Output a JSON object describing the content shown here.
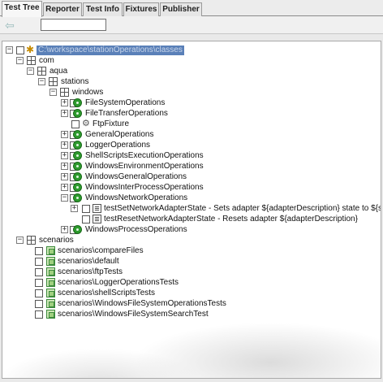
{
  "tabs": [
    {
      "label": "Test Tree",
      "active": true
    },
    {
      "label": "Reporter",
      "active": false
    },
    {
      "label": "Test Info",
      "active": false
    },
    {
      "label": "Fixtures",
      "active": false
    },
    {
      "label": "Publisher",
      "active": false
    }
  ],
  "toolbar": {
    "back_icon": "back-arrow-icon",
    "filter_value": ""
  },
  "tree": {
    "root_label": "C:\\workspace\\stationOperations\\classes",
    "nodes": {
      "com": "com",
      "aqua": "aqua",
      "stations": "stations",
      "windows": "windows",
      "file_system_operations": "FileSystemOperations",
      "file_transfer_operations": "FileTransferOperations",
      "ftp_fixture": "FtpFixture",
      "general_operations": "GeneralOperations",
      "logger_operations": "LoggerOperations",
      "shell_scripts_execution_operations": "ShellScriptsExecutionOperations",
      "windows_environment_operations": "WindowsEnvironmentOperations",
      "windows_general_operations": "WindowsGeneralOperations",
      "windows_inter_process_operations": "WindowsInterProcessOperations",
      "windows_network_operations": "WindowsNetworkOperations",
      "test_set_network_adapter_state": "testSetNetworkAdapterState - Sets adapter ${adapterDescription} state to ${state}",
      "test_reset_network_adapter_state": "testResetNetworkAdapterState - Resets adapter ${adapterDescription}",
      "windows_process_operations": "WindowsProcessOperations",
      "scenarios": "scenarios"
    },
    "scenario_items": [
      "scenarios\\compareFiles",
      "scenarios\\default",
      "scenarios\\ftpTests",
      "scenarios\\LoggerOperationsTests",
      "scenarios\\shellScriptsTests",
      "scenarios\\WindowsFileSystemOperationsTests",
      "scenarios\\WindowsFileSystemSearchTest"
    ]
  }
}
